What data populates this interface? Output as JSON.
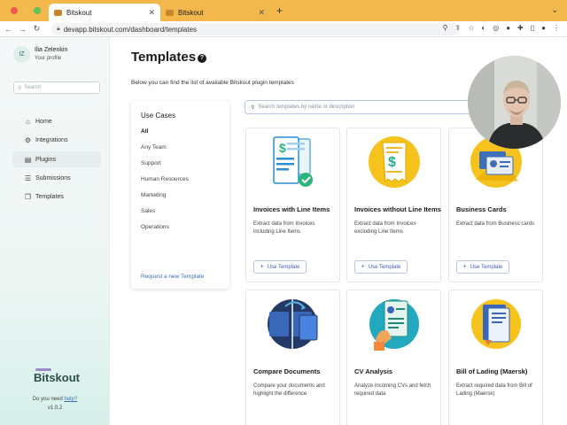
{
  "browser": {
    "tabs": [
      {
        "title": "Bitskout",
        "active": true
      },
      {
        "title": "Bitskout",
        "active": false
      }
    ],
    "url": "devapp.bitskout.com/dashboard/templates",
    "colors": {
      "tabbar": "#f2b84b"
    }
  },
  "user": {
    "initials": "IZ",
    "name": "Ilia Zelenkin",
    "subtitle": "Your profile"
  },
  "sidebar": {
    "search_placeholder": "Search",
    "items": [
      {
        "label": "Home",
        "icon": "home-icon"
      },
      {
        "label": "Integrations",
        "icon": "gear-icon"
      },
      {
        "label": "Plugins",
        "icon": "plugin-icon",
        "active": true
      },
      {
        "label": "Submissions",
        "icon": "submissions-icon"
      },
      {
        "label": "Templates",
        "icon": "templates-icon"
      }
    ],
    "logo_text": "Bitskout",
    "help_prefix": "Do you need ",
    "help_link": "help?",
    "version": "v1.0.2"
  },
  "main": {
    "title": "Templates",
    "subtitle": "Below you can find the list of available Bitskout plugin templates",
    "search_placeholder": "Search templates by name or description"
  },
  "use_cases": {
    "heading": "Use Cases",
    "items": [
      "All",
      "Any Team",
      "Support",
      "Human Resources",
      "Marketing",
      "Sales",
      "Operations"
    ],
    "request_link": "Request a new Template"
  },
  "cards": [
    {
      "title": "Invoices with Line Items",
      "desc": "Extract data from Invoices including Line Items",
      "button": "Use Template",
      "icon": "invoice-lines-icon"
    },
    {
      "title": "Invoices without Line Items",
      "desc": "Extract data from Invoices excluding Line Items",
      "button": "Use Template",
      "icon": "invoice-icon"
    },
    {
      "title": "Business Cards",
      "desc": "Extract data from Business cards",
      "button": "Use Template",
      "icon": "business-card-icon"
    },
    {
      "title": "Compare Documents",
      "desc": "Compare your documents and highlight the difference",
      "button": "Use Template",
      "icon": "compare-icon"
    },
    {
      "title": "CV Analysis",
      "desc": "Analyze incoming CVs and fetch required data",
      "button": "Use Template",
      "icon": "cv-icon"
    },
    {
      "title": "Bill of Lading (Maersk)",
      "desc": "Extract required data from Bill of Lading (Maersk)",
      "button": "Use Template",
      "icon": "bill-of-lading-icon"
    }
  ]
}
